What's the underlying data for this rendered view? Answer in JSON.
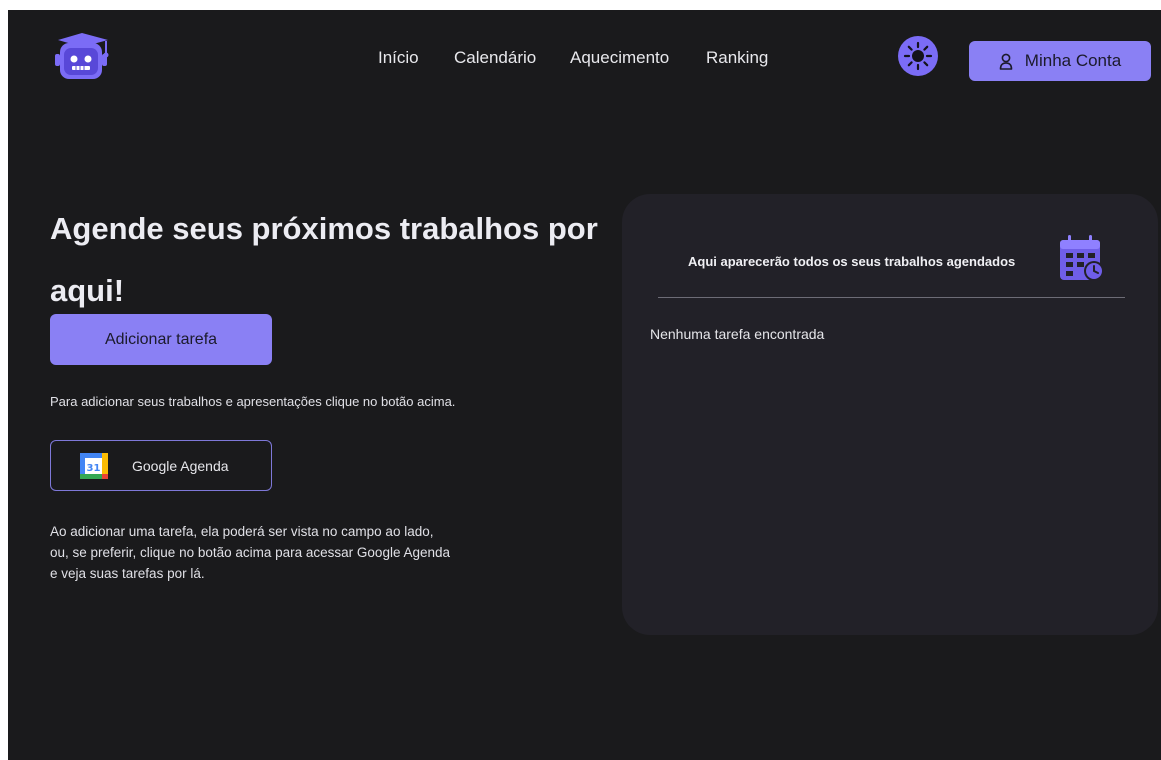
{
  "nav": {
    "items": [
      {
        "label": "Início"
      },
      {
        "label": "Calendário"
      },
      {
        "label": "Aquecimento"
      },
      {
        "label": "Ranking"
      }
    ]
  },
  "header": {
    "account_label": "Minha Conta",
    "theme_icon": "sun-icon",
    "account_icon": "user-icon",
    "logo_icon": "robot-graduate-logo"
  },
  "hero": {
    "title": "Agende seus próximos trabalhos por aqui!",
    "add_task_label": "Adicionar tarefa",
    "hint": "Para adicionar seus trabalhos e apresentações clique no botão acima.",
    "gcal_label": "Google Agenda",
    "gcal_day": "31",
    "description": "Ao adicionar uma tarefa, ela poderá ser vista no campo ao lado, ou, se preferir, clique no botão acima para acessar Google Agenda e veja suas tarefas por lá."
  },
  "panel": {
    "title": "Aqui aparecerão todos os seus trabalhos agendados",
    "empty_text": "Nenhuma tarefa encontrada",
    "icon": "calendar-schedule-icon"
  },
  "colors": {
    "background": "#1a1a1c",
    "panel": "#222128",
    "accent": "#8a80f4",
    "accent_dark": "#7b6cf6"
  }
}
